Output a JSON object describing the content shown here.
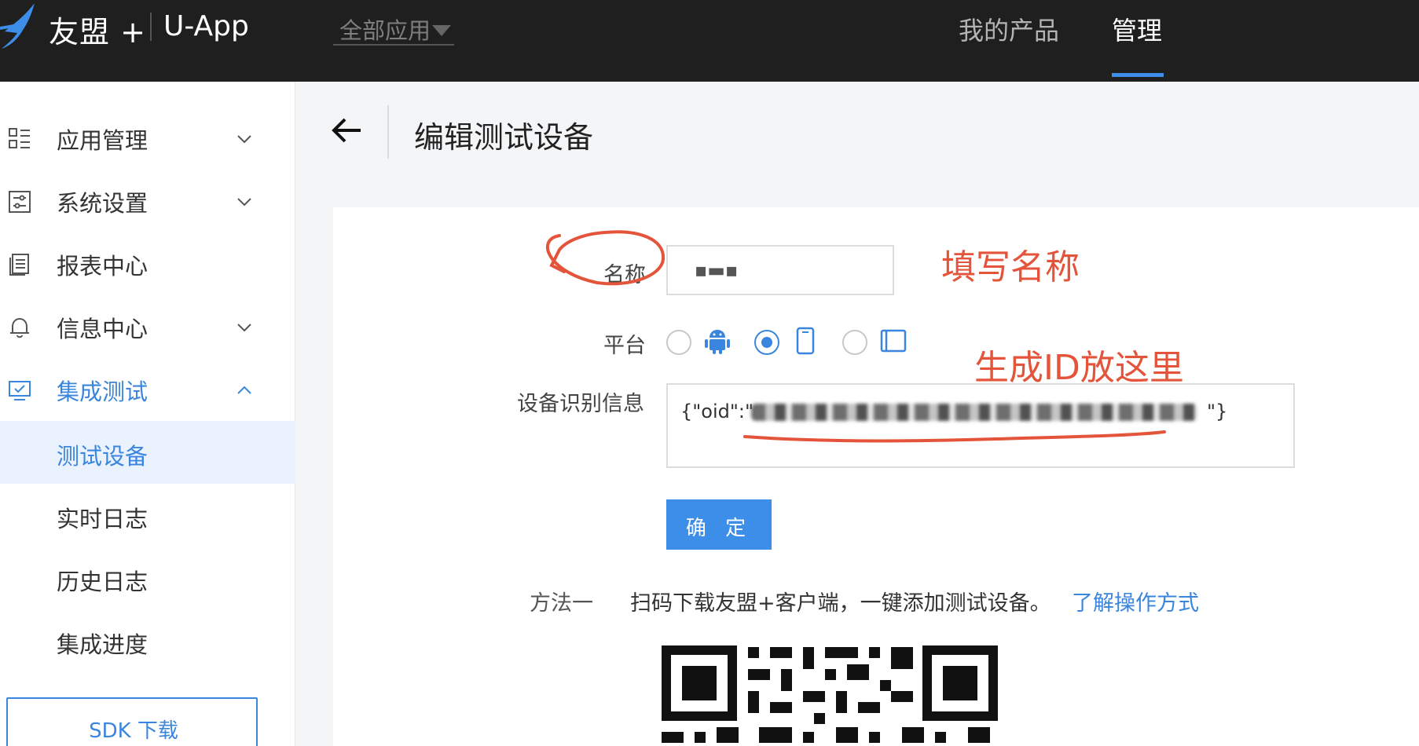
{
  "topbar": {
    "brand": "友盟 +",
    "product": "U-App",
    "app_select": "全部应用",
    "nav_products": "我的产品",
    "nav_manage": "管理"
  },
  "sidebar": {
    "items": [
      {
        "label": "应用管理",
        "icon": "app-grid-icon",
        "expanded": false
      },
      {
        "label": "系统设置",
        "icon": "settings-panel-icon",
        "expanded": false
      },
      {
        "label": "报表中心",
        "icon": "report-icon"
      },
      {
        "label": "信息中心",
        "icon": "bell-icon",
        "expanded": false
      },
      {
        "label": "集成测试",
        "icon": "monitor-check-icon",
        "expanded": true
      }
    ],
    "subitems": [
      {
        "label": "测试设备",
        "active": true
      },
      {
        "label": "实时日志"
      },
      {
        "label": "历史日志"
      },
      {
        "label": "集成进度"
      }
    ],
    "sdk_button": "SDK 下载"
  },
  "page": {
    "title": "编辑测试设备"
  },
  "form": {
    "name_label": "名称",
    "name_value": "▪▬▪",
    "platform_label": "平台",
    "platforms": [
      {
        "icon": "android-icon",
        "selected": false
      },
      {
        "icon": "phone-icon",
        "selected": true
      },
      {
        "icon": "tablet-icon",
        "selected": false
      }
    ],
    "device_label": "设备识别信息",
    "device_prefix": "{\"oid\":\"",
    "device_suffix": "\"}",
    "confirm": "确 定",
    "method_label": "方法一",
    "method_text": "扫码下载友盟+客户端，一键添加测试设备。",
    "method_link": "了解操作方式"
  },
  "annotations": {
    "name": "填写名称",
    "id": "生成ID放这里"
  },
  "colors": {
    "accent": "#3a86de",
    "topbar": "#1f1f20",
    "annotation": "#e4543a"
  }
}
